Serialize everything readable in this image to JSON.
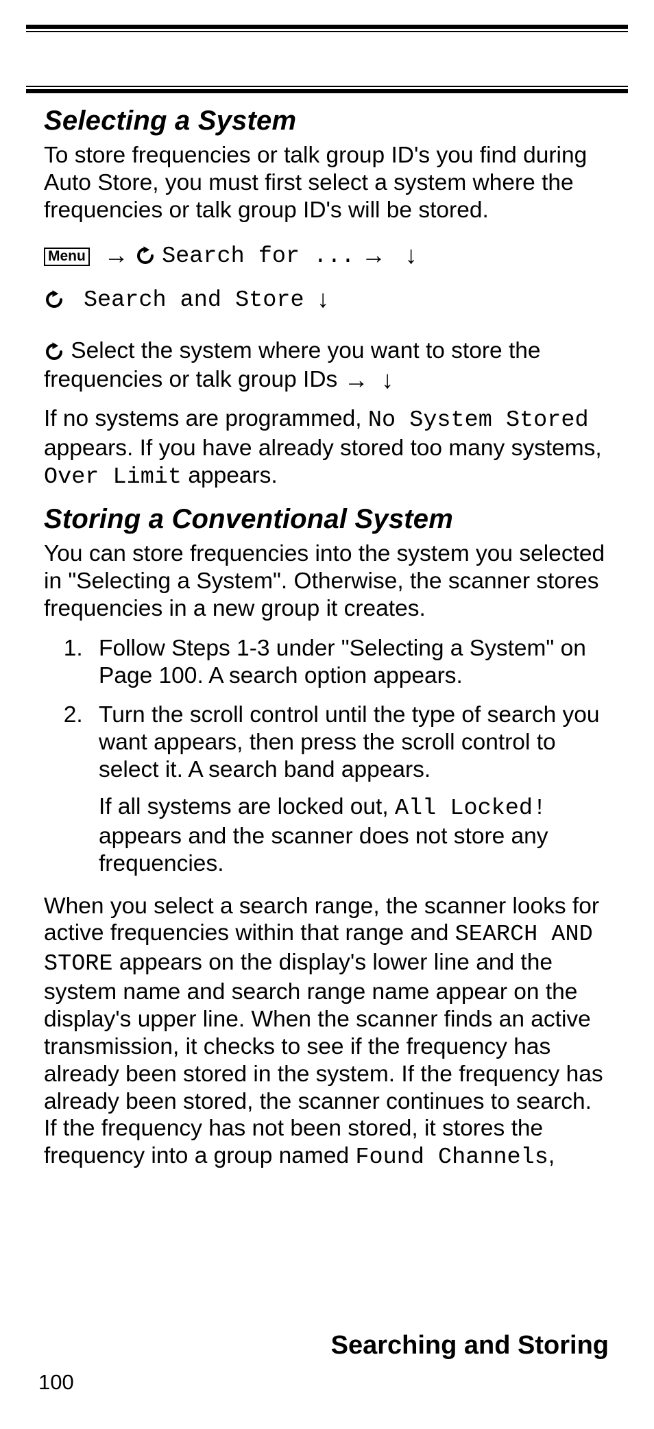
{
  "sections": {
    "selecting": {
      "heading": "Selecting a System",
      "intro": "To store frequencies or talk group ID's you find during Auto Store, you must first select a system where the frequencies or talk group ID's will be stored.",
      "menu_label": "Menu",
      "nav1": "Search for ...",
      "nav2": "Search and Store",
      "select_line": " Select the system where you want to store the frequencies or talk group IDs ",
      "p2_a": "If no systems are programmed, ",
      "p2_code1": "No System Stored",
      "p2_b": " appears. If you have already stored too many systems, ",
      "p2_code2": "Over Limit",
      "p2_c": " appears."
    },
    "storing": {
      "heading": "Storing a Conventional System",
      "intro": "You can store frequencies into the system you selected in \"Selecting a System\". Otherwise, the scanner stores frequencies in a new group it creates.",
      "steps": {
        "s1": "Follow Steps 1-3 under \"Selecting a System\" on Page 100. A search option appears.",
        "s2": "Turn the scroll control until the type of search you want appears, then press the scroll control to select it. A search band appears.",
        "s2b_a": "If all systems are locked out, ",
        "s2b_code": "All Locked!",
        "s2b_b": " appears and the scanner does not store any frequencies."
      },
      "p3_a": "When you select a search range, the scanner looks for active frequencies within that range and ",
      "p3_code1": "SEARCH AND STORE",
      "p3_b": " appears on the display's lower line and the system name and search range name appear on the display's upper line. When the scanner finds an active transmission, it checks to see if the frequency has already been stored in the system. If the frequency has already been stored, the scanner continues to search. If the frequency has not been stored, it stores the frequency into a group named ",
      "p3_code2": "Found Channels",
      "p3_c": ","
    }
  },
  "footer": {
    "title": "Searching and Storing",
    "page": "100"
  },
  "icons": {
    "arrow_right": "→",
    "arrow_down": "↓"
  }
}
